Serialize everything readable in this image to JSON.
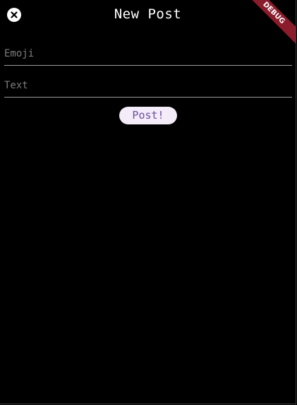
{
  "header": {
    "title": "New Post",
    "close_icon": "close-circle-icon"
  },
  "debug_banner": {
    "label": "DEBUG",
    "color": "#8b1c2b"
  },
  "form": {
    "emoji": {
      "placeholder": "Emoji",
      "value": ""
    },
    "text": {
      "placeholder": "Text",
      "value": ""
    },
    "submit_label": "Post!"
  },
  "colors": {
    "background": "#000000",
    "button_bg": "#f4ecf8",
    "button_text": "#6b4fa3"
  }
}
